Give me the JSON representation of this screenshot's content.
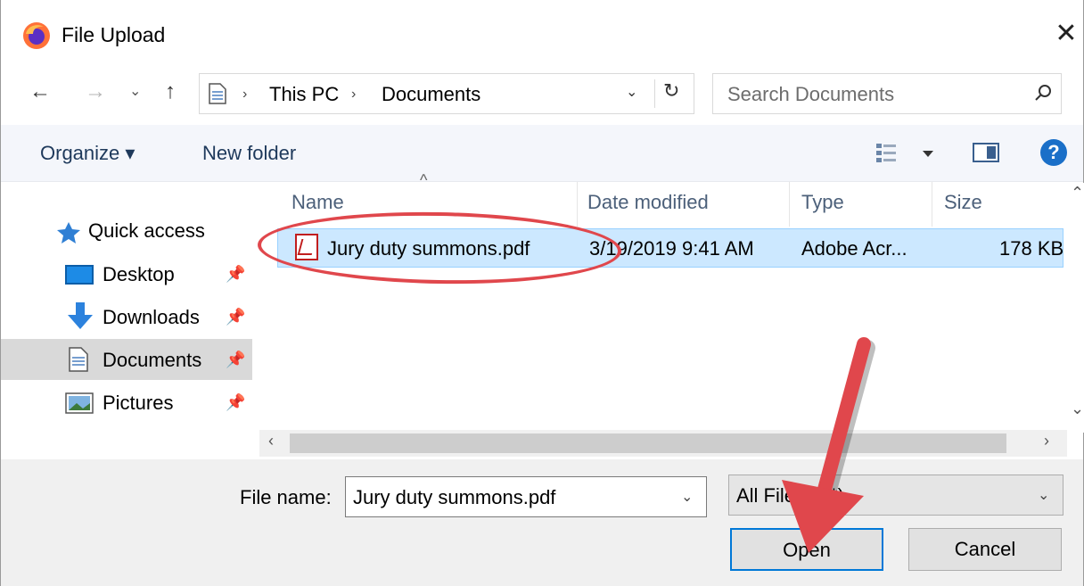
{
  "window": {
    "title": "File Upload",
    "close_glyph": "✕"
  },
  "nav": {
    "back": "←",
    "forward": "→",
    "recent": "⌄",
    "up": "↑",
    "breadcrumb": [
      "This PC",
      "Documents"
    ],
    "separator": "›",
    "dropdown": "⌄",
    "refresh": "↻",
    "search_placeholder": "Search Documents"
  },
  "toolbar": {
    "organize": "Organize ▾",
    "new_folder": "New folder",
    "view_caret": "▾",
    "help": "?"
  },
  "sidebar": {
    "quick_access": "Quick access",
    "items": [
      {
        "label": "Desktop",
        "icon": "desktop-icon",
        "pinned": true
      },
      {
        "label": "Downloads",
        "icon": "downloads-icon",
        "pinned": true
      },
      {
        "label": "Documents",
        "icon": "documents-icon",
        "pinned": true,
        "selected": true
      },
      {
        "label": "Pictures",
        "icon": "pictures-icon",
        "pinned": true
      }
    ]
  },
  "columns": {
    "name": "Name",
    "date": "Date modified",
    "type": "Type",
    "size": "Size"
  },
  "files": [
    {
      "name": "Jury duty summons.pdf",
      "date": "3/19/2019 9:41 AM",
      "type": "Adobe Acr...",
      "size": "178 KB",
      "icon": "pdf-icon"
    }
  ],
  "footer": {
    "file_name_label": "File name:",
    "file_name_value": "Jury duty summons.pdf",
    "filter_value": "All Files (*.*)",
    "open_label": "Open",
    "cancel_label": "Cancel"
  },
  "colors": {
    "annotation": "#e0474c",
    "selection": "#cce8ff",
    "accent": "#0078d7"
  }
}
